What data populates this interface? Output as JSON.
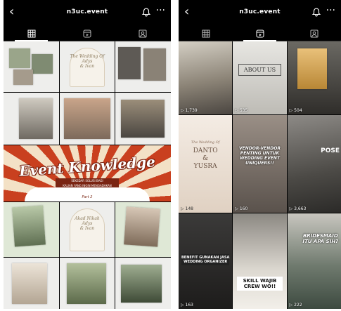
{
  "username": "n3uc.event",
  "icons": {
    "back": "chevron-left-icon",
    "bell": "bell-icon",
    "more": "more-icon",
    "grid": "grid-icon",
    "reels": "reels-icon",
    "tagged": "tagged-icon"
  },
  "header": {
    "back_glyph": "‹",
    "more_glyph": "···"
  },
  "left_posts": {
    "row1": [
      "",
      "The Wedding Of\nAdys\n& Ivan",
      ""
    ],
    "banner": {
      "title": "Event Knowledge",
      "subtitle": "SEKEDAR SOLUSI BAGI\nKALIAN YANG INGIN MENGADAKAN",
      "part": "Part 2"
    },
    "row4_card": "Akad Nikah\nAdys\n& Ivan"
  },
  "right_reels": [
    {
      "count": "1,739"
    },
    {
      "count": "535",
      "overlay": "ABOUT US"
    },
    {
      "count": "504"
    },
    {
      "count": "148",
      "overlay_small": "The Wedding Of",
      "overlay": "DANTO\n&\nYUSRA"
    },
    {
      "count": "160",
      "overlay": "VENDOR-VENDOR PENTING UNTUK WEDDING EVENT UNIQUERS!!"
    },
    {
      "count": "3,663",
      "overlay": "POSE"
    },
    {
      "count": "163",
      "overlay": "BENEFIT GUNAKAN JASA WEDDING ORGANIZER"
    },
    {
      "count": "",
      "overlay": "SKILL WAJIB CREW WO!!"
    },
    {
      "count": "222",
      "overlay": "BRIDESMAID ITU APA SIH?"
    }
  ],
  "colors": {
    "accent": "#c9401f",
    "dark": "#7a2513"
  }
}
